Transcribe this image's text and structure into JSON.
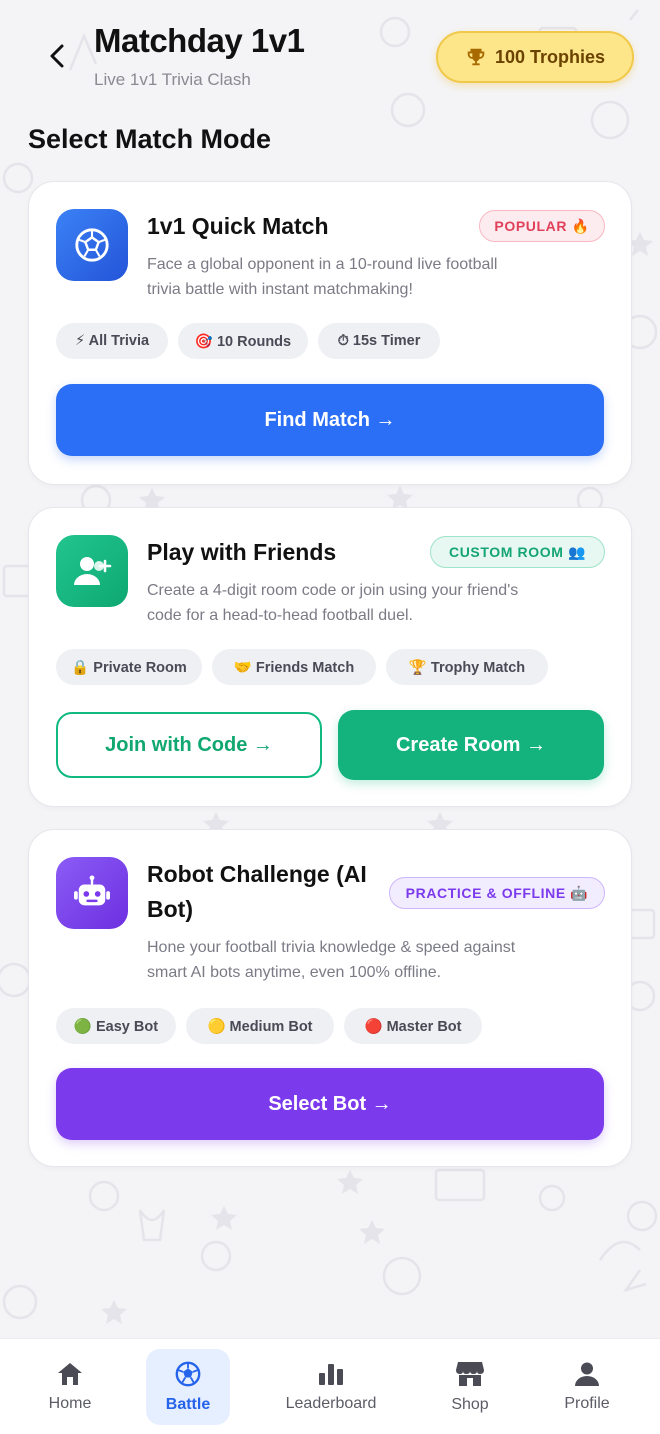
{
  "header": {
    "title": "Matchday 1v1",
    "subtitle": "Live 1v1 Trivia Clash",
    "trophies_label": "100 Trophies",
    "back_icon": "chevron-left-icon",
    "trophy_icon": "trophy-icon"
  },
  "section_title": "Select Match Mode",
  "cards": [
    {
      "title": "1v1 Quick Match",
      "tag": "POPULAR 🔥",
      "description_lines": [
        "Face a global opponent in a 10-round live football",
        "trivia battle with instant matchmaking!"
      ],
      "chips": [
        "⚡ All Trivia",
        "🎯 10 Rounds",
        "⏱ 15s Timer"
      ],
      "button": "Find Match →",
      "icon": "soccer-ball-icon",
      "accent": "#2563eb"
    },
    {
      "title": "Play with Friends",
      "tag": "CUSTOM ROOM 👥",
      "description_lines": [
        "Create a 4-digit room code or join using your friend's",
        "code for a head-to-head football duel."
      ],
      "chips": [
        "🔒 Private Room",
        "🤝 Friends Match",
        "🏆 Trophy Match"
      ],
      "secondary_button": "Join with Code →",
      "button": "Create Room →",
      "icon": "add-user-icon",
      "accent": "#10b981"
    },
    {
      "title_lines": [
        "Robot Challenge (AI",
        "Bot)"
      ],
      "tag": "PRACTICE & OFFLINE 🤖",
      "description_lines": [
        "Hone your football trivia knowledge & speed against",
        "smart AI bots anytime, even 100% offline."
      ],
      "chips": [
        "🟢 Easy Bot",
        "🟡 Medium Bot",
        "🔴 Master Bot"
      ],
      "button": "Select Bot →",
      "icon": "robot-icon",
      "accent": "#7c3aed"
    }
  ],
  "nav": {
    "items": [
      {
        "label": "Home",
        "icon": "home-icon"
      },
      {
        "label": "Battle",
        "icon": "soccer-ball-icon",
        "active": true
      },
      {
        "label": "Leaderboard",
        "icon": "bar-chart-icon"
      },
      {
        "label": "Shop",
        "icon": "store-icon"
      },
      {
        "label": "Profile",
        "icon": "user-icon"
      }
    ]
  },
  "colors": {
    "blue": "#2563eb",
    "green": "#10b981",
    "purple": "#7c3aed",
    "trophy_bg": "#fde58a",
    "background": "#f4f4f6"
  }
}
